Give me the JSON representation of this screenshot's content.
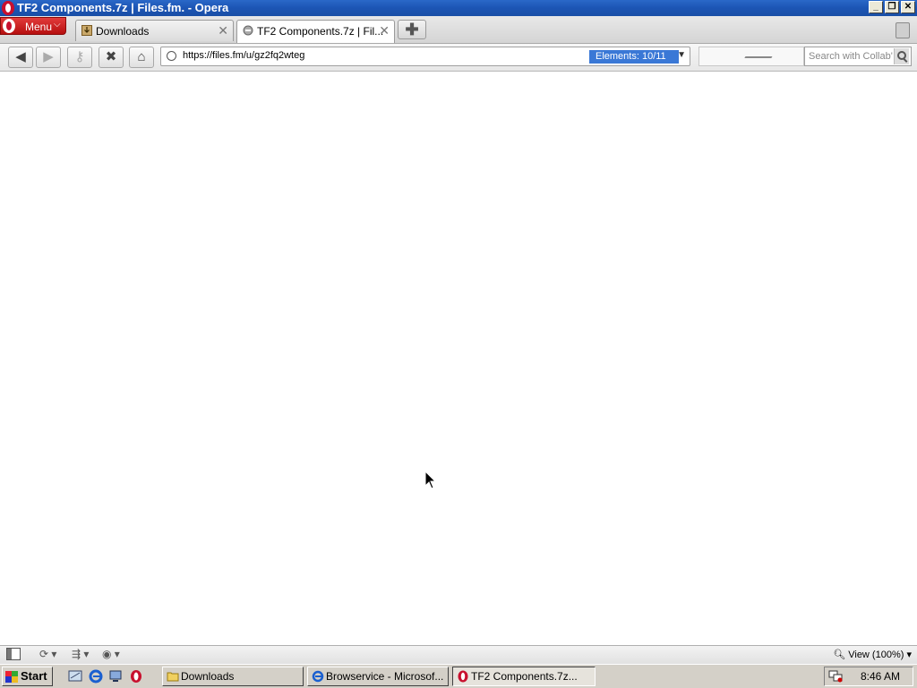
{
  "window": {
    "title": "TF2 Components.7z | Files.fm. - Opera",
    "controls": [
      "minimize",
      "restore",
      "close"
    ]
  },
  "tabbar": {
    "menu_label": "Menu",
    "tabs": [
      {
        "label": "Downloads",
        "icon": "download-icon",
        "active": false
      },
      {
        "label": "TF2 Components.7z | Fil...",
        "icon": "page-icon",
        "active": true
      }
    ]
  },
  "navbar": {
    "url": "https://files.fm/u/gz2fq2wteg",
    "elements_badge": "Elements:  10/11",
    "search_placeholder": "Search with Collab'"
  },
  "statusbar": {
    "zoom_label": "View (100%)"
  },
  "taskbar": {
    "start_label": "Start",
    "tasks": [
      {
        "label": "Downloads",
        "icon": "folder-icon",
        "active": false
      },
      {
        "label": "Browservice - Microsof...",
        "icon": "ie-icon",
        "active": false
      },
      {
        "label": "TF2 Components.7z...",
        "icon": "opera-icon",
        "active": true
      }
    ],
    "clock": "8:46 AM"
  },
  "colors": {
    "titlebar": "#1c55b4",
    "opera_red": "#c8102e",
    "elements_badge": "#3a78d6",
    "taskbar": "#d4d0c8"
  }
}
